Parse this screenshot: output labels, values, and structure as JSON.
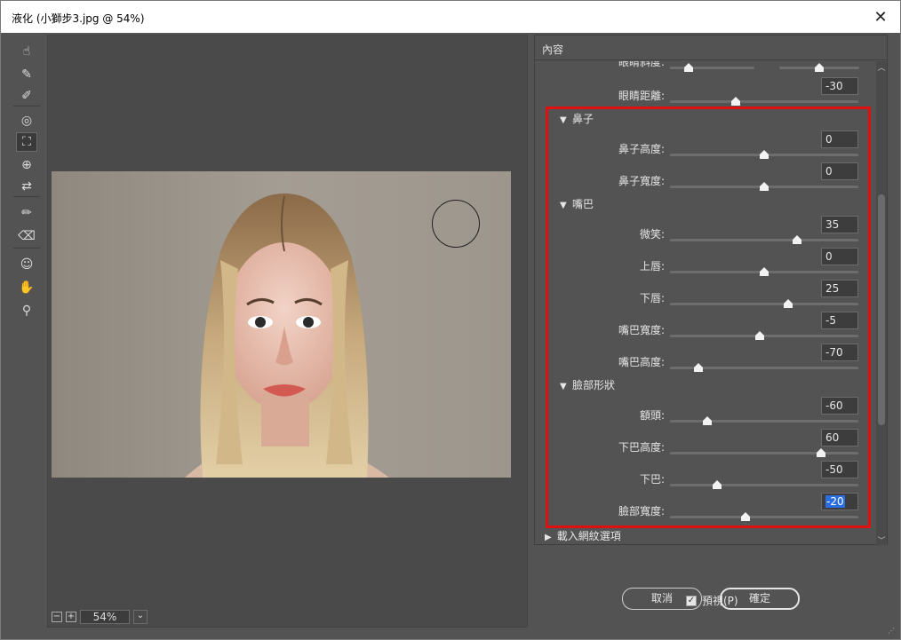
{
  "window": {
    "title": "液化 (小獅步3.jpg @ 54%)",
    "close_glyph": "✕"
  },
  "tools": [
    {
      "name": "forward-warp-tool-icon",
      "glyph": "☝"
    },
    {
      "name": "reconstruct-tool-icon",
      "glyph": "✎"
    },
    {
      "name": "smooth-tool-icon",
      "glyph": "✐"
    },
    {
      "name": "twirl-tool-icon",
      "glyph": "◎"
    },
    {
      "name": "pucker-tool-icon",
      "glyph": "⛶"
    },
    {
      "name": "bloat-tool-icon",
      "glyph": "⊕"
    },
    {
      "name": "push-left-tool-icon",
      "glyph": "⇄"
    },
    {
      "name": "freeze-mask-tool-icon",
      "glyph": "✏"
    },
    {
      "name": "thaw-mask-tool-icon",
      "glyph": "⌫"
    },
    {
      "name": "face-tool-icon",
      "glyph": "☺"
    },
    {
      "name": "hand-tool-icon",
      "glyph": "✋"
    },
    {
      "name": "zoom-tool-icon",
      "glyph": "⚲"
    }
  ],
  "zoom": {
    "minus": "−",
    "plus": "+",
    "value": "54%",
    "dropdown": "⌄"
  },
  "panel": {
    "header": "內容",
    "partial_top_label": "眼睛斜度:",
    "eye_distance": {
      "label": "眼睛距離:",
      "value": "-30",
      "level": 0.35
    },
    "sections": [
      {
        "title": "鼻子",
        "rows": [
          {
            "label": "鼻子高度:",
            "value": "0",
            "level": 0.5
          },
          {
            "label": "鼻子寬度:",
            "value": "0",
            "level": 0.5
          }
        ]
      },
      {
        "title": "嘴巴",
        "rows": [
          {
            "label": "微笑:",
            "value": "35",
            "level": 0.675
          },
          {
            "label": "上唇:",
            "value": "0",
            "level": 0.5
          },
          {
            "label": "下唇:",
            "value": "25",
            "level": 0.625
          },
          {
            "label": "嘴巴寬度:",
            "value": "-5",
            "level": 0.475
          },
          {
            "label": "嘴巴高度:",
            "value": "-70",
            "level": 0.15
          }
        ]
      },
      {
        "title": "臉部形狀",
        "rows": [
          {
            "label": "額頭:",
            "value": "-60",
            "level": 0.2
          },
          {
            "label": "下巴高度:",
            "value": "60",
            "level": 0.8
          },
          {
            "label": "下巴:",
            "value": "-50",
            "level": 0.25
          },
          {
            "label": "臉部寬度:",
            "value": "-20",
            "level": 0.4,
            "selected": true
          }
        ]
      }
    ],
    "load_mesh": "載入網紋選項"
  },
  "preview": {
    "label": "預視(P)",
    "checked": true,
    "check_glyph": "✓"
  },
  "buttons": {
    "cancel": "取消",
    "ok": "確定"
  },
  "colors": {
    "highlight": "#e01010",
    "selection": "#2a6ee0",
    "ui_bg": "#535353"
  }
}
